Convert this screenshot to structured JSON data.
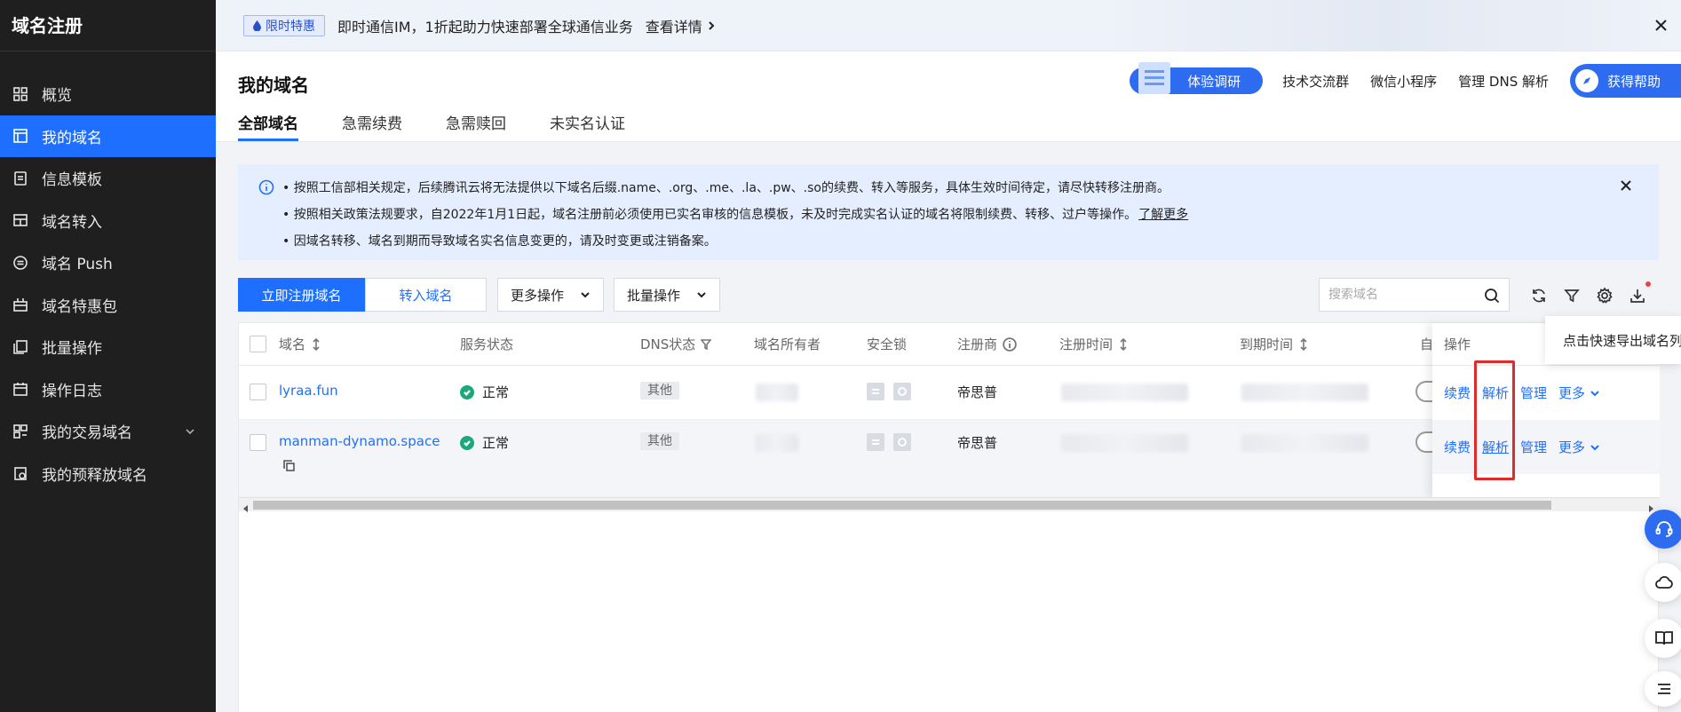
{
  "sidebar": {
    "title": "域名注册",
    "items": [
      {
        "label": "概览",
        "icon": "grid-icon"
      },
      {
        "label": "我的域名",
        "icon": "browser-icon",
        "active": true
      },
      {
        "label": "信息模板",
        "icon": "document-icon"
      },
      {
        "label": "域名转入",
        "icon": "transfer-icon"
      },
      {
        "label": "域名 Push",
        "icon": "push-icon"
      },
      {
        "label": "域名特惠包",
        "icon": "gift-icon"
      },
      {
        "label": "批量操作",
        "icon": "batch-icon"
      },
      {
        "label": "操作日志",
        "icon": "calendar-icon"
      },
      {
        "label": "我的交易域名",
        "icon": "trade-icon"
      },
      {
        "label": "我的预释放域名",
        "icon": "release-icon"
      }
    ]
  },
  "banner": {
    "badge": "限时特惠",
    "text": "即时通信IM，1折起助力快速部署全球通信业务",
    "link": "查看详情"
  },
  "header": {
    "title": "我的域名",
    "tabs": [
      "全部域名",
      "急需续费",
      "急需赎回",
      "未实名认证"
    ],
    "survey": "体验调研",
    "links": [
      "技术交流群",
      "微信小程序",
      "管理 DNS 解析"
    ],
    "help": "获得帮助"
  },
  "notice": {
    "line1": "• 按照工信部相关规定，后续腾讯云将无法提供以下域名后缀.name、.org、.me、.la、.pw、.so的续费、转入等服务，具体生效时间待定，请尽快转移注册商。",
    "line2": "• 按照相关政策法规要求，自2022年1月1日起，域名注册前必须使用已实名审核的信息模板，未及时完成实名认证的域名将限制续费、转移、过户等操作。",
    "line2_link": "了解更多",
    "line3": "• 因域名转移、域名到期而导致域名实名信息变更的，请及时变更或注销备案。"
  },
  "toolbar": {
    "register": "立即注册域名",
    "transfer": "转入域名",
    "more_ops": "更多操作",
    "batch_ops": "批量操作",
    "search_placeholder": "搜索域名"
  },
  "table": {
    "columns": {
      "domain": "域名",
      "status": "服务状态",
      "dns": "DNS状态",
      "owner": "域名所有者",
      "lock": "安全锁",
      "registrar": "注册商",
      "reg_time": "注册时间",
      "exp_time": "到期时间",
      "auto": "自",
      "ops": "操作"
    },
    "rows": [
      {
        "domain": "lyraa.fun",
        "status": "正常",
        "dns": "其他",
        "registrar": "帝思普"
      },
      {
        "domain": "manman-dynamo.space",
        "status": "正常",
        "dns": "其他",
        "registrar": "帝思普"
      }
    ],
    "ops": {
      "renew": "续费",
      "resolve": "解析",
      "manage": "管理",
      "more": "更多"
    }
  },
  "tooltip": "点击快速导出域名列",
  "colors": {
    "accent": "#1f6fff",
    "sidebar": "#1f1f1f",
    "success": "#1ba97a",
    "highlight": "#e02b2b"
  }
}
